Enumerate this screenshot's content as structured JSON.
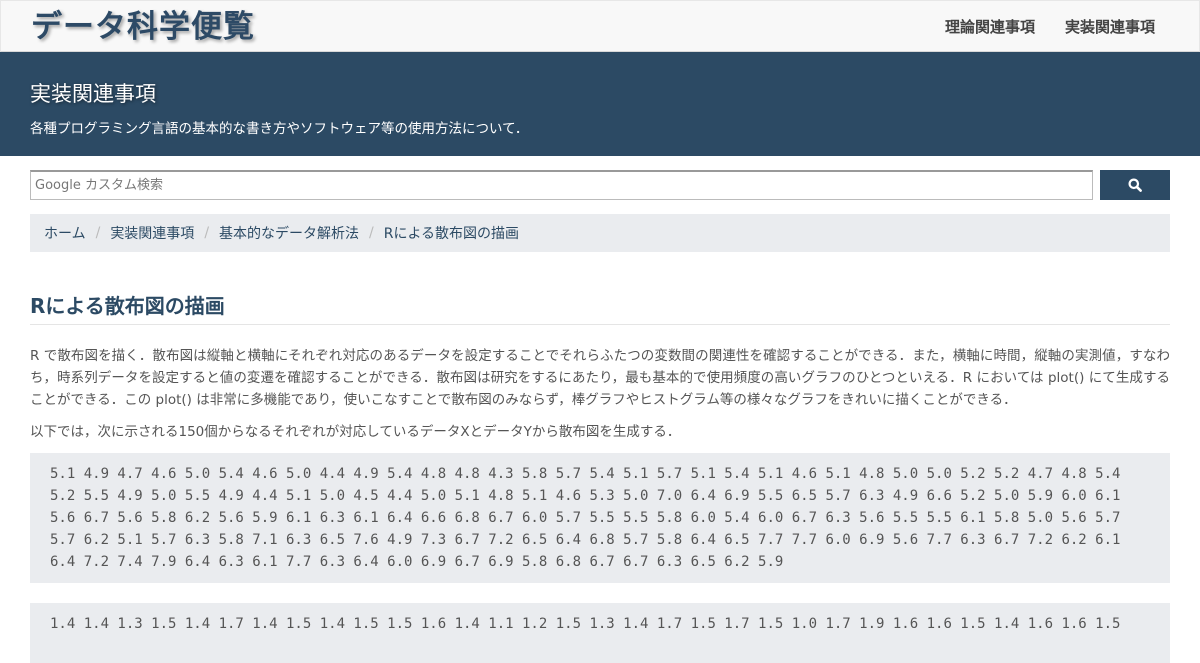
{
  "navbar": {
    "brand": "データ科学便覧",
    "links": [
      "理論関連事項",
      "実装関連事項"
    ]
  },
  "hero": {
    "title": "実装関連事項",
    "subtitle": "各種プログラミング言語の基本的な書き方やソフトウェア等の使用方法について．"
  },
  "search": {
    "placeholder": "Google カスタム検索",
    "value": "",
    "button_icon": "search-icon"
  },
  "breadcrumb": {
    "items": [
      "ホーム",
      "実装関連事項",
      "基本的なデータ解析法"
    ],
    "current": "Rによる散布図の描画"
  },
  "article": {
    "title": "Rによる散布図の描画",
    "paragraph1": "R で散布図を描く．散布図は縦軸と横軸にそれぞれ対応のあるデータを設定することでそれらふたつの変数間の関連性を確認することができる．また，横軸に時間，縦軸の実測値，すなわち，時系列データを設定すると値の変遷を確認することができる．散布図は研究をするにあたり，最も基本的で使用頻度の高いグラフのひとつといえる．R においては plot() にて生成することができる．この plot() は非常に多機能であり，使いこなすことで散布図のみならず，棒グラフやヒストグラム等の様々なグラフをきれいに描くことができる．",
    "paragraph2": "以下では，次に示される150個からなるそれぞれが対応しているデータXとデータYから散布図を生成する．",
    "data_x_lines": [
      "5.1 4.9 4.7 4.6 5.0 5.4 4.6 5.0 4.4 4.9 5.4 4.8 4.8 4.3 5.8 5.7 5.4 5.1 5.7 5.1 5.4 5.1 4.6 5.1 4.8 5.0 5.0 5.2 5.2 4.7 4.8 5.4",
      "5.2 5.5 4.9 5.0 5.5 4.9 4.4 5.1 5.0 4.5 4.4 5.0 5.1 4.8 5.1 4.6 5.3 5.0 7.0 6.4 6.9 5.5 6.5 5.7 6.3 4.9 6.6 5.2 5.0 5.9 6.0 6.1",
      "5.6 6.7 5.6 5.8 6.2 5.6 5.9 6.1 6.3 6.1 6.4 6.6 6.8 6.7 6.0 5.7 5.5 5.5 5.8 6.0 5.4 6.0 6.7 6.3 5.6 5.5 5.5 6.1 5.8 5.0 5.6 5.7",
      "5.7 6.2 5.1 5.7 6.3 5.8 7.1 6.3 6.5 7.6 4.9 7.3 6.7 7.2 6.5 6.4 6.8 5.7 5.8 6.4 6.5 7.7 7.7 6.0 6.9 5.6 7.7 6.3 6.7 7.2 6.2 6.1",
      "6.4 7.2 7.4 7.9 6.4 6.3 6.1 7.7 6.3 6.4 6.0 6.9 6.7 6.9 5.8 6.8 6.7 6.7 6.3 6.5 6.2 5.9"
    ],
    "data_y_lines": [
      "1.4 1.4 1.3 1.5 1.4 1.7 1.4 1.5 1.4 1.5 1.5 1.6 1.4 1.1 1.2 1.5 1.3 1.4 1.7 1.5 1.7 1.5 1.0 1.7 1.9 1.6 1.6 1.5 1.4 1.6 1.6 1.5"
    ]
  }
}
